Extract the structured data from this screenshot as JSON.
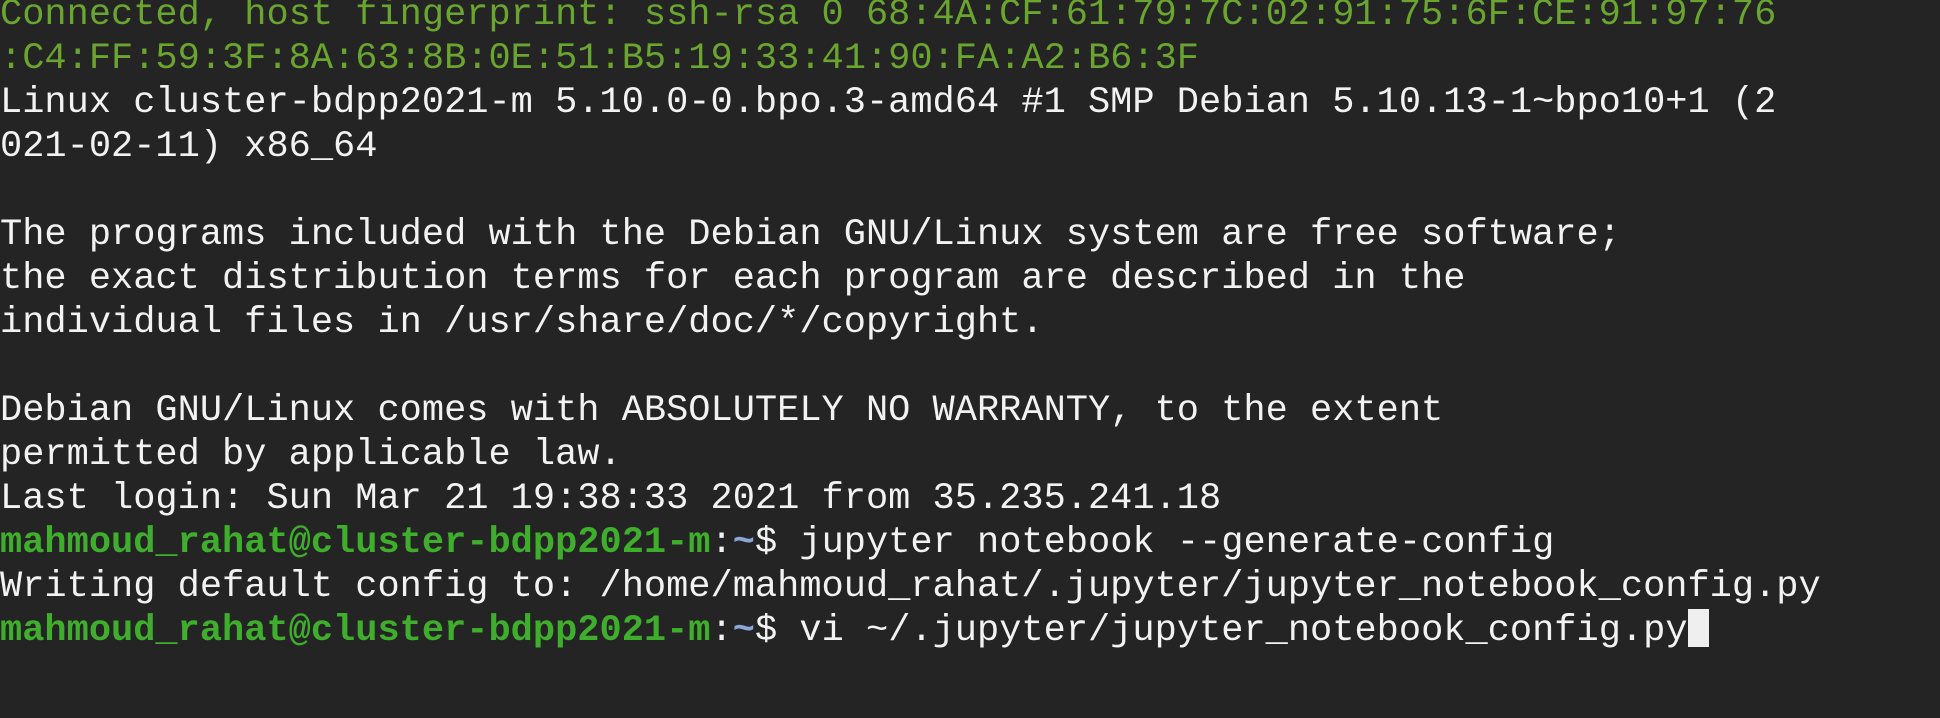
{
  "terminal": {
    "banner_line1": "Connected, host fingerprint: ssh-rsa 0 68:4A:CF:61:79:7C:02:91:75:6F:CE:91:97:76",
    "banner_line2": ":C4:FF:59:3F:8A:63:8B:0E:51:B5:19:33:41:90:FA:A2:B6:3F",
    "uname_line1": "Linux cluster-bdpp2021-m 5.10.0-0.bpo.3-amd64 #1 SMP Debian 5.10.13-1~bpo10+1 (2",
    "uname_line2": "021-02-11) x86_64",
    "motd_line1": "The programs included with the Debian GNU/Linux system are free software;",
    "motd_line2": "the exact distribution terms for each program are described in the",
    "motd_line3": "individual files in /usr/share/doc/*/copyright.",
    "warranty_line1": "Debian GNU/Linux comes with ABSOLUTELY NO WARRANTY, to the extent",
    "warranty_line2": "permitted by applicable law.",
    "last_login": "Last login: Sun Mar 21 19:38:33 2021 from 35.235.241.18",
    "prompt_user_host": "mahmoud_rahat@cluster-bdpp2021-m",
    "prompt_colon": ":",
    "prompt_path": "~",
    "prompt_symbol": "$ ",
    "command1": "jupyter notebook --generate-config",
    "output1": "Writing default config to: /home/mahmoud_rahat/.jupyter/jupyter_notebook_config.py",
    "command2": "vi ~/.jupyter/jupyter_notebook_config.py"
  },
  "colors": {
    "background": "#242424",
    "foreground": "#f2f2f2",
    "banner_green": "#6aa52f",
    "prompt_green": "#3fae2c",
    "prompt_blue": "#8aa6d6"
  }
}
